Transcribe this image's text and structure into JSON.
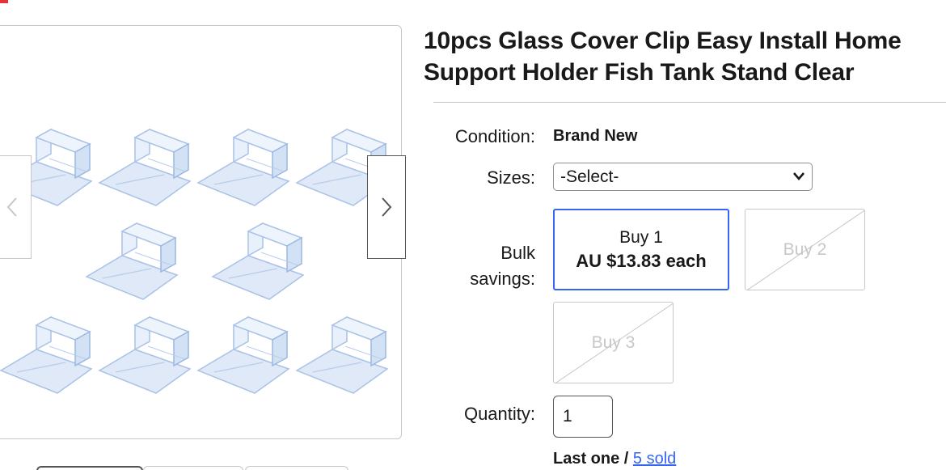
{
  "product": {
    "title": "10pcs Glass Cover Clip Easy Install Home Support Holder Fish Tank Stand Clear",
    "image_alt": "Clear glass cover clips"
  },
  "details": {
    "condition_label": "Condition:",
    "condition_value": "Brand New",
    "sizes_label": "Sizes:",
    "sizes_selected": "-Select-",
    "bulk_label_line1": "Bulk",
    "bulk_label_line2": "savings:",
    "bulk_options": [
      {
        "line1": "Buy 1",
        "line2": "AU $13.83 each",
        "selected": true,
        "disabled": false
      },
      {
        "line1": "Buy 2",
        "line2": "",
        "selected": false,
        "disabled": true
      },
      {
        "line1": "Buy 3",
        "line2": "",
        "selected": false,
        "disabled": true
      }
    ],
    "quantity_label": "Quantity:",
    "quantity_value": "1",
    "availability_text": "Last one / ",
    "sold_link": "5 sold"
  },
  "gallery": {
    "prev_icon": "chevron-left-icon",
    "next_icon": "chevron-right-icon"
  },
  "colors": {
    "accent": "#3665f3",
    "text": "#191919",
    "border": "#c7c7c7",
    "logo_red": "#e53238"
  }
}
